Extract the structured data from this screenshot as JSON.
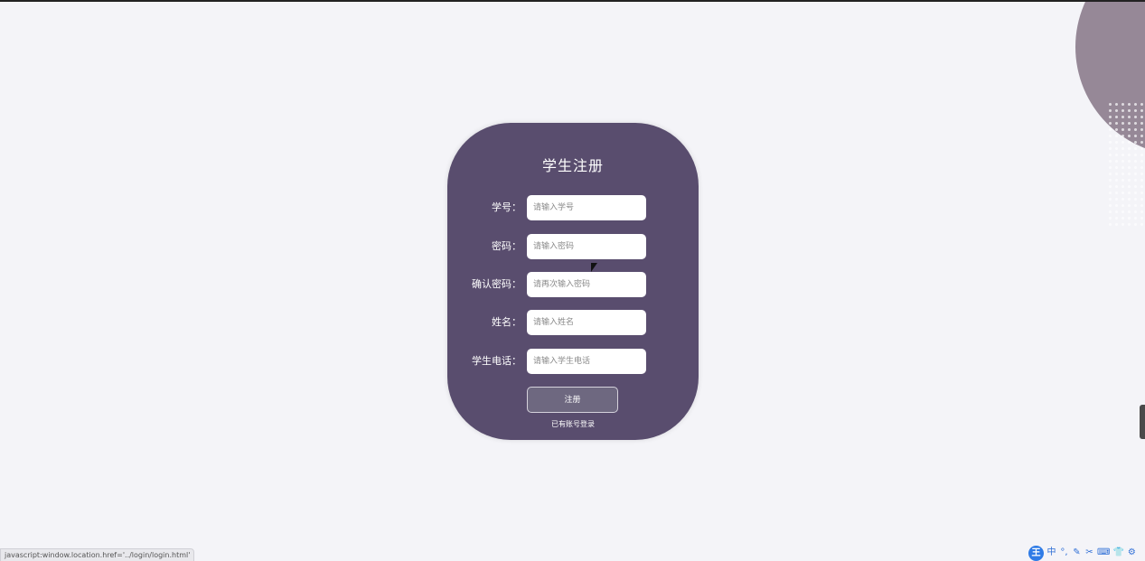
{
  "form": {
    "title": "学生注册",
    "fields": [
      {
        "label": "学号：",
        "placeholder": "请输入学号"
      },
      {
        "label": "密码：",
        "placeholder": "请输入密码"
      },
      {
        "label": "确认密码：",
        "placeholder": "请再次输入密码"
      },
      {
        "label": "姓名：",
        "placeholder": "请输入姓名"
      },
      {
        "label": "学生电话：",
        "placeholder": "请输入学生电话"
      }
    ],
    "submit_label": "注册",
    "login_link": "已有账号登录"
  },
  "status_bar": {
    "url": "javascript:window.location.href='../login/login.html'"
  },
  "ime_toolbar": {
    "logo": "王",
    "items": [
      "中",
      "°,",
      "✎",
      "✂",
      "⌨",
      "👕",
      "⚙"
    ]
  },
  "colors": {
    "card": "#594d6e",
    "page": "#f4f4f8",
    "blob": "#968897",
    "button": "#6e6880"
  }
}
